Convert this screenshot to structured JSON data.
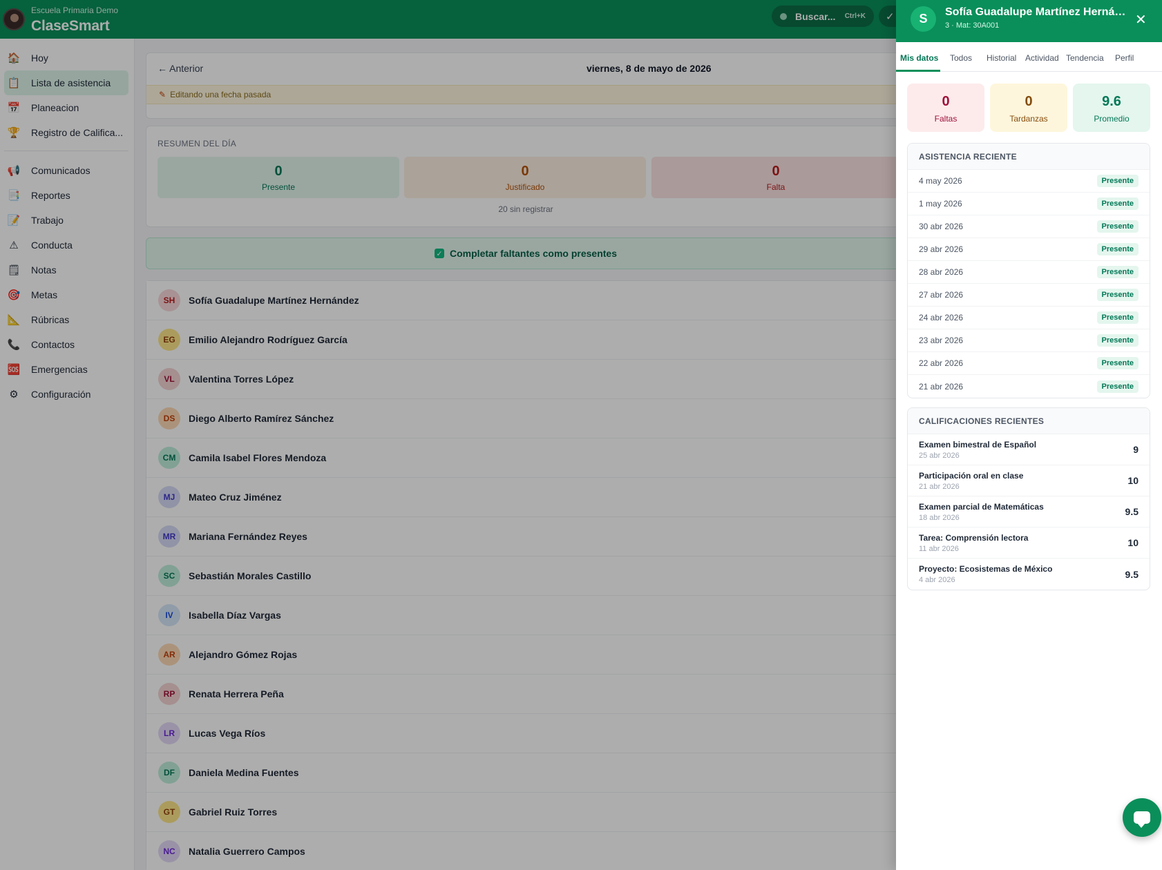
{
  "header": {
    "school_name": "Escuela Primaria Demo",
    "app_name": "ClaseSmart",
    "search_label": "Buscar...",
    "search_shortcut": "Ctrl+K",
    "check_label": "✓"
  },
  "sidebar": {
    "items": [
      {
        "label": "Hoy",
        "icon": "🏠"
      },
      {
        "label": "Lista de asistencia",
        "icon": "📋"
      },
      {
        "label": "Planeacion",
        "icon": "📅"
      },
      {
        "label": "Registro de Califica...",
        "icon": "🏆"
      },
      {
        "label": "Comunicados",
        "icon": "📢"
      },
      {
        "label": "Reportes",
        "icon": "📑"
      },
      {
        "label": "Trabajo",
        "icon": "📝"
      },
      {
        "label": "Conducta",
        "icon": "⚠"
      },
      {
        "label": "Notas",
        "icon": "🗒"
      },
      {
        "label": "Metas",
        "icon": "🎯"
      },
      {
        "label": "Rúbricas",
        "icon": "📐"
      },
      {
        "label": "Contactos",
        "icon": "📞"
      },
      {
        "label": "Emergencias",
        "icon": "🆘"
      },
      {
        "label": "Configuración",
        "icon": "⚙"
      }
    ]
  },
  "attendance": {
    "prev_label": "← Anterior",
    "date_label": "viernes, 8 de mayo de 2026",
    "editing_notice": "Editando una fecha pasada",
    "summary_title": "RESUMEN DEL DÍA",
    "present_count": "0",
    "present_label": "Presente",
    "justified_count": "0",
    "justified_label": "Justificado",
    "absent_count": "0",
    "absent_label": "Falta",
    "unregistered": "20 sin registrar",
    "complete_button": "Completar faltantes como presentes"
  },
  "students": [
    {
      "initials": "SH",
      "name": "Sofía Guadalupe Martínez Hernández",
      "color": "red"
    },
    {
      "initials": "EG",
      "name": "Emilio Alejandro Rodríguez García",
      "color": "yellow"
    },
    {
      "initials": "VL",
      "name": "Valentina Torres López",
      "color": "rose"
    },
    {
      "initials": "DS",
      "name": "Diego Alberto Ramírez Sánchez",
      "color": "orange"
    },
    {
      "initials": "CM",
      "name": "Camila Isabel Flores Mendoza",
      "color": "green"
    },
    {
      "initials": "MJ",
      "name": "Mateo Cruz Jiménez",
      "color": "indigo"
    },
    {
      "initials": "MR",
      "name": "Mariana Fernández Reyes",
      "color": "indigo"
    },
    {
      "initials": "SC",
      "name": "Sebastián Morales Castillo",
      "color": "green"
    },
    {
      "initials": "IV",
      "name": "Isabella Díaz Vargas",
      "color": "blue"
    },
    {
      "initials": "AR",
      "name": "Alejandro Gómez Rojas",
      "color": "orange"
    },
    {
      "initials": "RP",
      "name": "Renata Herrera Peña",
      "color": "rose"
    },
    {
      "initials": "LR",
      "name": "Lucas Vega Ríos",
      "color": "purple"
    },
    {
      "initials": "DF",
      "name": "Daniela Medina Fuentes",
      "color": "green"
    },
    {
      "initials": "GT",
      "name": "Gabriel Ruiz Torres",
      "color": "yellow"
    },
    {
      "initials": "NC",
      "name": "Natalia Guerrero Campos",
      "color": "purple"
    }
  ],
  "drawer": {
    "avatar_letter": "S",
    "student_name": "Sofía Guadalupe Martínez Hernández",
    "subtitle": "3 · Mat: 30A001",
    "close_label": "✕",
    "tabs": [
      "Mis datos",
      "Todos",
      "Historial",
      "Actividad",
      "Tendencia",
      "Perfil"
    ],
    "kpis": {
      "absences_value": "0",
      "absences_label": "Faltas",
      "tardies_value": "0",
      "tardies_label": "Tardanzas",
      "average_value": "9.6",
      "average_label": "Promedio"
    },
    "recent_attendance_title": "ASISTENCIA RECIENTE",
    "recent_attendance": [
      {
        "date": "4 may 2026",
        "status": "Presente"
      },
      {
        "date": "1 may 2026",
        "status": "Presente"
      },
      {
        "date": "30 abr 2026",
        "status": "Presente"
      },
      {
        "date": "29 abr 2026",
        "status": "Presente"
      },
      {
        "date": "28 abr 2026",
        "status": "Presente"
      },
      {
        "date": "27 abr 2026",
        "status": "Presente"
      },
      {
        "date": "24 abr 2026",
        "status": "Presente"
      },
      {
        "date": "23 abr 2026",
        "status": "Presente"
      },
      {
        "date": "22 abr 2026",
        "status": "Presente"
      },
      {
        "date": "21 abr 2026",
        "status": "Presente"
      }
    ],
    "recent_grades_title": "CALIFICACIONES RECIENTES",
    "recent_grades": [
      {
        "title": "Examen bimestral de Español",
        "date": "25 abr 2026",
        "score": "9"
      },
      {
        "title": "Participación oral en clase",
        "date": "21 abr 2026",
        "score": "10"
      },
      {
        "title": "Examen parcial de Matemáticas",
        "date": "18 abr 2026",
        "score": "9.5"
      },
      {
        "title": "Tarea: Comprensión lectora",
        "date": "11 abr 2026",
        "score": "10"
      },
      {
        "title": "Proyecto: Ecosistemas de México",
        "date": "4 abr 2026",
        "score": "9.5"
      }
    ]
  },
  "colors": {
    "brand": "#0a8f5a",
    "present": "#047857",
    "justified": "#b45309",
    "absent": "#b91c1c"
  }
}
